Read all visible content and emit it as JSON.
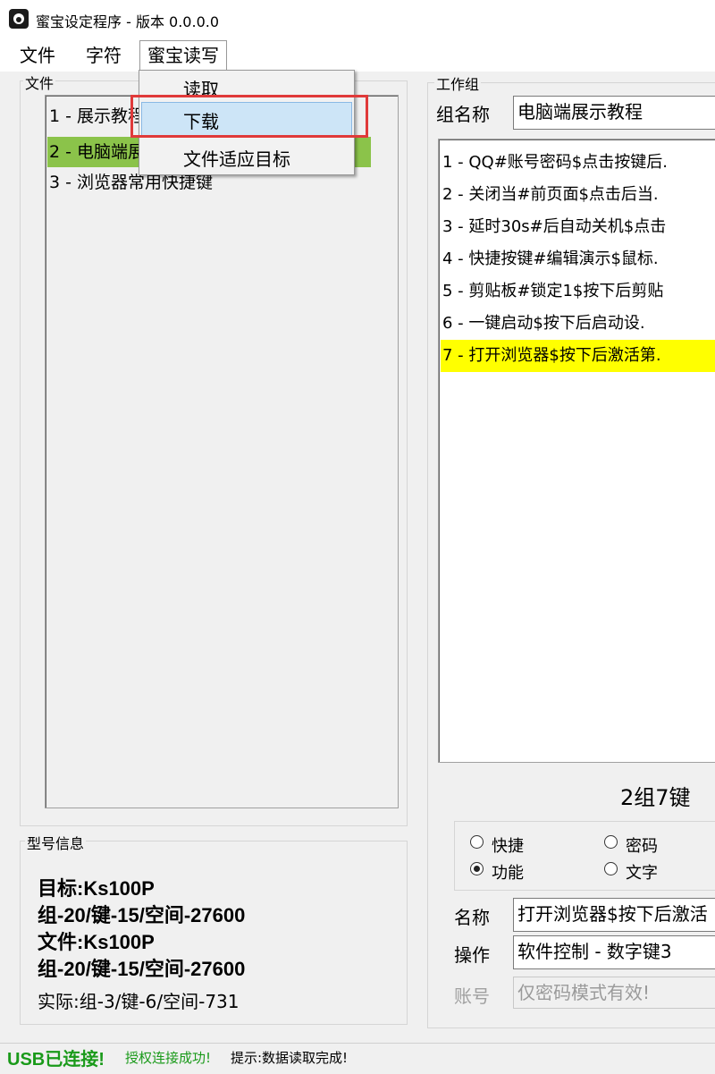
{
  "window": {
    "title": "蜜宝设定程序 - 版本 0.0.0.0"
  },
  "menubar": {
    "items": [
      {
        "label": "文件"
      },
      {
        "label": "字符"
      },
      {
        "label": "蜜宝读写"
      }
    ]
  },
  "dropdown": {
    "items": [
      {
        "label": "读取"
      },
      {
        "label": "下载"
      },
      {
        "label": "文件适应目标"
      }
    ]
  },
  "files_group": {
    "label": "文件",
    "rows": [
      {
        "text": "1 - 展示教程"
      },
      {
        "text": "2 - 电脑端展示教程"
      },
      {
        "text": "3 - 浏览器常用快捷键"
      }
    ],
    "selected_index": 1
  },
  "work_group": {
    "label": "工作组",
    "name_label": "组名称",
    "name_value": "电脑端展示教程",
    "keys": [
      {
        "text": "1 - QQ#账号密码$点击按键后."
      },
      {
        "text": "2 - 关闭当#前页面$点击后当."
      },
      {
        "text": "3 - 延时30s#后自动关机$点击"
      },
      {
        "text": "4 - 快捷按键#编辑演示$鼠标."
      },
      {
        "text": "5 - 剪贴板#锁定1$按下后剪贴"
      },
      {
        "text": "6 -  一键启动$按下后启动设."
      },
      {
        "text": "7 - 打开浏览器$按下后激活第."
      }
    ],
    "selected_index": 6,
    "summary": "2组7键",
    "modes": [
      {
        "label": "快捷",
        "checked": false
      },
      {
        "label": "密码",
        "checked": false
      },
      {
        "label": "功能",
        "checked": true
      },
      {
        "label": "文字",
        "checked": false
      }
    ],
    "name_field_label": "名称",
    "name_field_value": "打开浏览器$按下后激活",
    "op_label": "操作",
    "op_value": "软件控制 - 数字键3",
    "account_label": "账号",
    "account_placeholder": "仅密码模式有效!"
  },
  "model_info": {
    "label": "型号信息",
    "target_line": "目标:Ks100P",
    "target_spec": "组-20/键-15/空间-27600",
    "file_line": "文件:Ks100P",
    "file_spec": "组-20/键-15/空间-27600",
    "actual_line": "实际:组-3/键-6/空间-731"
  },
  "status": {
    "usb": "USB已连接!",
    "auth": "授权连接成功!",
    "hint": "提示:数据读取完成!"
  },
  "colors": {
    "file_selected": "#8bc34a",
    "key_selected": "#ffff00",
    "status_green": "#1a9a1a",
    "highlight_box": "#e03a3a"
  }
}
